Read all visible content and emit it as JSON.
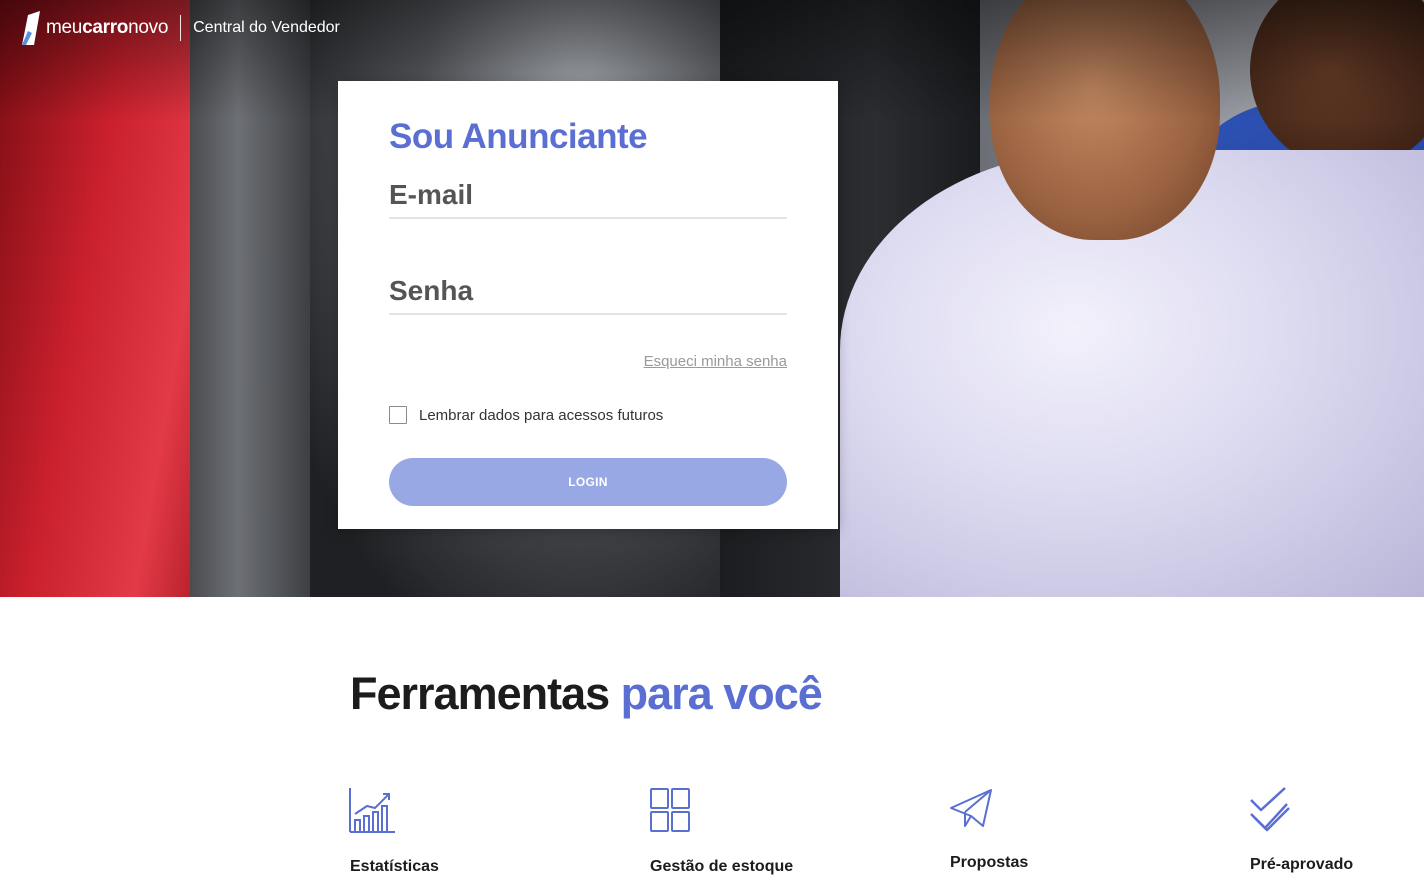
{
  "header": {
    "logo_light": "meu",
    "logo_bold": "carro",
    "logo_end": "novo",
    "subtitle": "Central do Vendedor"
  },
  "login": {
    "title": "Sou Anunciante",
    "email_placeholder": "E-mail",
    "password_placeholder": "Senha",
    "forgot_label": "Esqueci minha senha",
    "remember_label": "Lembrar dados para acessos futuros",
    "remember_checked": false,
    "login_label": "LOGIN"
  },
  "tools": {
    "title_main": "Ferramentas ",
    "title_accent": "para você",
    "items": [
      {
        "label": "Estatísticas",
        "icon": "bar-chart-icon"
      },
      {
        "label": "Gestão de estoque",
        "icon": "grid-icon"
      },
      {
        "label": "Propostas",
        "icon": "paper-plane-icon"
      },
      {
        "label": "Pré-aprovado",
        "icon": "double-check-icon"
      }
    ]
  },
  "colors": {
    "accent": "#5b6fd3",
    "button": "#98a8e4",
    "text_dark": "#1c1c1c"
  }
}
